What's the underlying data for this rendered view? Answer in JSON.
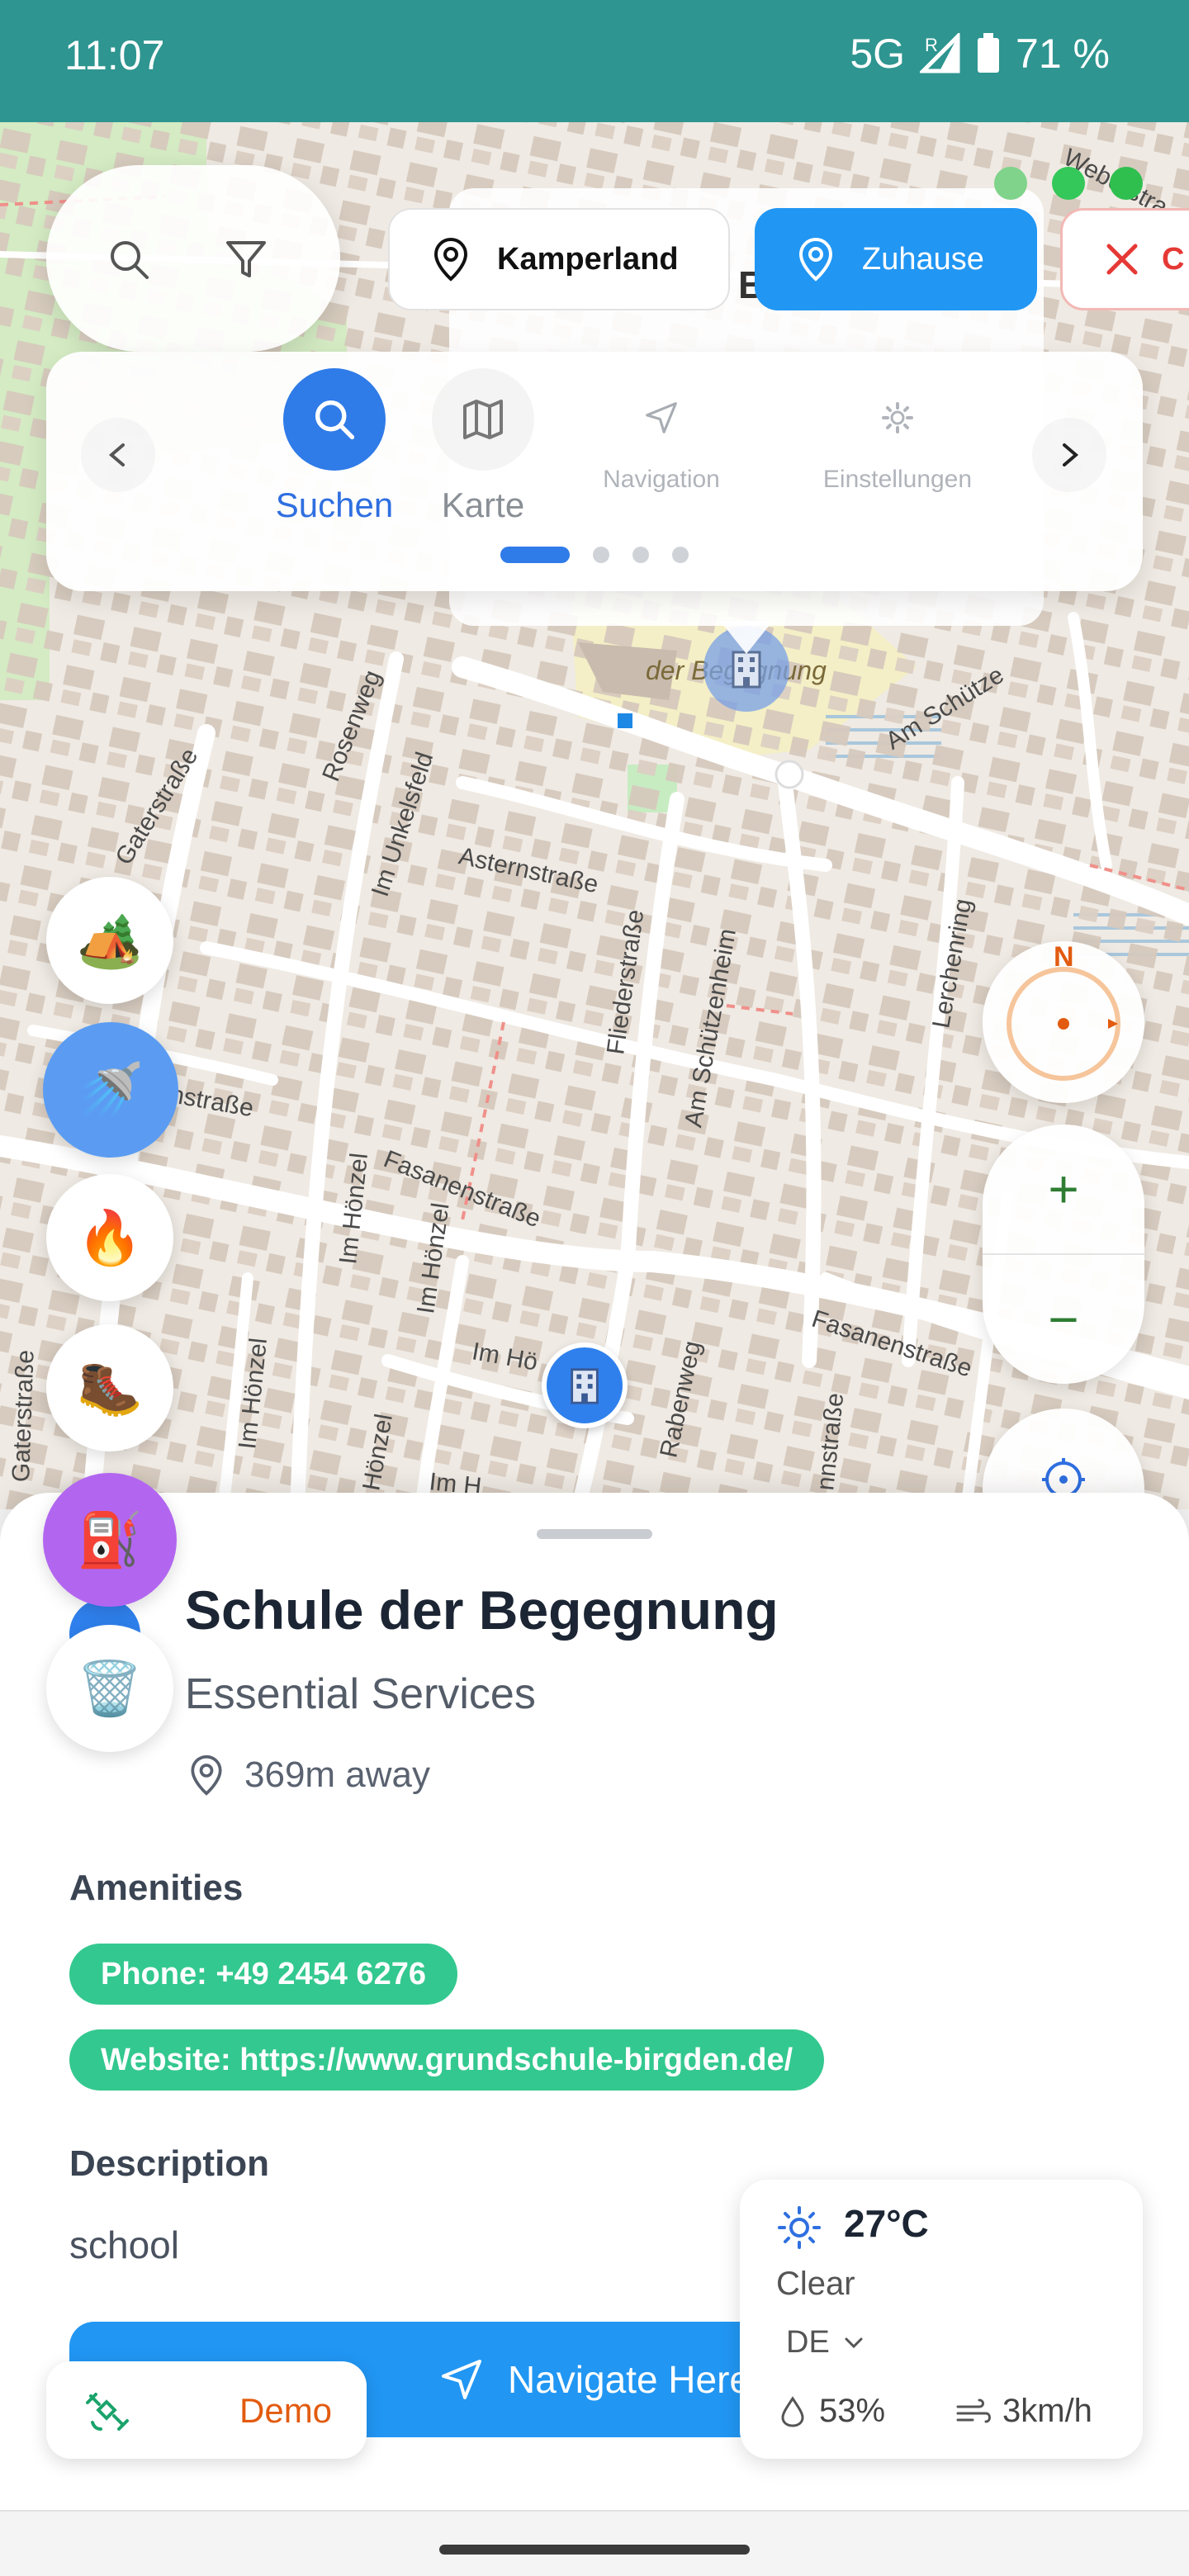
{
  "status_bar": {
    "time": "11:07",
    "network": "5G",
    "roaming": "R",
    "battery": "71 %"
  },
  "map": {
    "streets": [
      "Gaterstraße",
      "Rosenweg",
      "Im Unkelsfeld",
      "Asternstraße",
      "Fliederstraße",
      "Am Schützenheim",
      "Lerchenring",
      "Fasanenstraße",
      "Fasanenstraße",
      "Im Hönzel",
      "Im Hönzel",
      "Im Hönzel",
      "Rabenweg",
      "Gaterstraße",
      "Im Hö",
      "Am Schütze",
      "Weberstra",
      "enstraße",
      "Im H",
      "Hönzel",
      "nnstraße"
    ],
    "poi_label": "der Begegnung"
  },
  "top": {
    "chips": [
      {
        "label": "Kamperland",
        "icon": "map-pin-icon"
      },
      {
        "label": "Zuhause",
        "icon": "map-pin-icon"
      },
      {
        "label": "C",
        "icon": "close-icon"
      }
    ],
    "popup_letter": "B"
  },
  "nav_carousel": {
    "items": [
      {
        "label": "Suchen",
        "icon": "search-icon",
        "active": true
      },
      {
        "label": "Karte",
        "icon": "map-icon",
        "active": false
      },
      {
        "label": "Navigation",
        "icon": "navigation-icon",
        "active": false
      },
      {
        "label": "Einstellungen",
        "icon": "gear-icon",
        "active": false
      }
    ],
    "prev": "‹",
    "next": "›"
  },
  "fabs": [
    {
      "name": "camping-filter-button",
      "emoji": "🏕️"
    },
    {
      "name": "shower-filter-button",
      "emoji": "🚿"
    },
    {
      "name": "fire-filter-button",
      "emoji": "🔥"
    },
    {
      "name": "hiking-filter-button",
      "emoji": "🥾"
    },
    {
      "name": "fuel-filter-button",
      "emoji": "⛽"
    },
    {
      "name": "trash-filter-button",
      "emoji": "🗑️"
    }
  ],
  "compass": {
    "north": "N"
  },
  "zoom": {
    "in": "+",
    "out": "−"
  },
  "place": {
    "name": "Schule der Begegnung",
    "category": "Essential Services",
    "distance": "369m away",
    "amenities_heading": "Amenities",
    "amenities": [
      "Phone: +49 2454 6276",
      "Website: https://www.grundschule-birgden.de/"
    ],
    "description_heading": "Description",
    "description": "school",
    "navigate_label": "Navigate Here"
  },
  "demo": {
    "label": "Demo"
  },
  "weather": {
    "temperature": "27°C",
    "condition": "Clear",
    "country": "DE",
    "humidity": "53%",
    "wind": "3km/h"
  },
  "colors": {
    "status_bar": "#2e9590",
    "accent_blue": "#2196f3",
    "amenity_green": "#33c88f",
    "demo_orange": "#e25b0f"
  }
}
